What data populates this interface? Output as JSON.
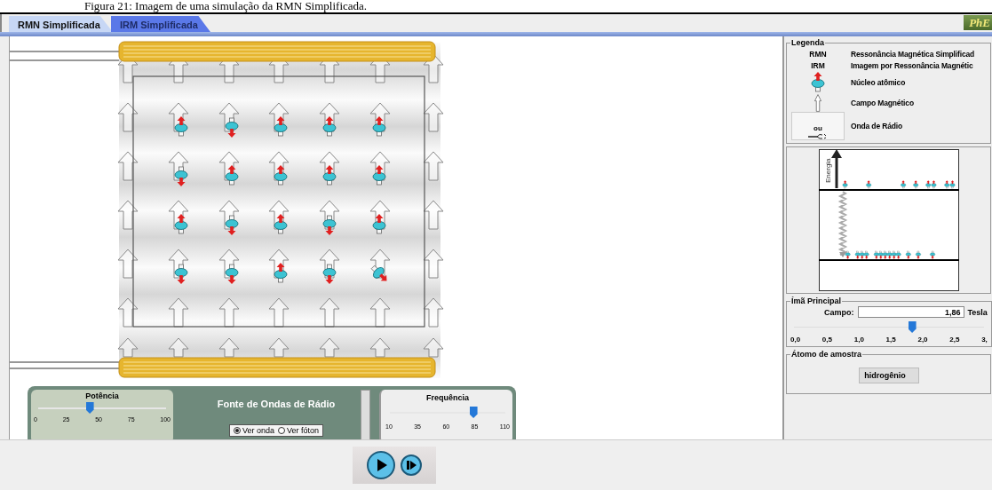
{
  "caption": "Figura 21: Imagem de uma simulação da RMN Simplificada.",
  "tabs": [
    {
      "label": "RMN Simplificada",
      "selected": true
    },
    {
      "label": "IRM Simplificada",
      "selected": false
    }
  ],
  "logo": "PhE",
  "nuclei_rows": [
    [
      {
        "kind": "up"
      },
      {
        "kind": "down"
      },
      {
        "kind": "up"
      },
      {
        "kind": "up"
      },
      {
        "kind": "up"
      }
    ],
    [
      {
        "kind": "down"
      },
      {
        "kind": "up"
      },
      {
        "kind": "up"
      },
      {
        "kind": "up"
      },
      {
        "kind": "up"
      }
    ],
    [
      {
        "kind": "up"
      },
      {
        "kind": "down"
      },
      {
        "kind": "up"
      },
      {
        "kind": "down"
      },
      {
        "kind": "up"
      }
    ],
    [
      {
        "kind": "down"
      },
      {
        "kind": "down"
      },
      {
        "kind": "up"
      },
      {
        "kind": "down"
      },
      {
        "kind": "flipping"
      }
    ]
  ],
  "radio_source": {
    "title": "Fonte de Ondas de Rádio",
    "power": {
      "label": "Potência",
      "level": 0.4,
      "ticks": [
        "0",
        "25",
        "50",
        "75",
        "100"
      ]
    },
    "frequency": {
      "label": "Frequência",
      "level": 0.72,
      "ticks": [
        "10",
        "35",
        "60",
        "85",
        "110"
      ]
    },
    "views": [
      {
        "label": "Ver onda",
        "selected": true
      },
      {
        "label": "Ver fóton",
        "selected": false
      }
    ]
  },
  "controls": [
    {
      "kind": "play"
    },
    {
      "kind": "step"
    }
  ],
  "legend": {
    "title": "Legenda",
    "items": [
      {
        "kind": "abbr",
        "symbol": "RMN",
        "text": "Ressonância Magnética Simplificad"
      },
      {
        "kind": "abbr",
        "symbol": "IRM",
        "text": "Imagem por Ressonância Magnétic"
      },
      {
        "kind": "nucleus",
        "text": "Núcleo atômico"
      },
      {
        "kind": "field",
        "text": "Campo Magnético"
      },
      {
        "kind": "wave",
        "symbol": "ou",
        "text": "Onda de Rádio"
      }
    ]
  },
  "energy_diagram": {
    "axis_label": "Energia"
  },
  "magnet": {
    "title": "Ímã Principal",
    "field_label": "Campo:",
    "value": "1,86",
    "unit": "Tesla",
    "level": 0.62,
    "ticks": [
      "0,0",
      "0,5",
      "1,0",
      "1,5",
      "2,0",
      "2,5",
      "3,"
    ]
  },
  "sample": {
    "title": "Átomo de amostra",
    "atom": "hidrogênio"
  }
}
